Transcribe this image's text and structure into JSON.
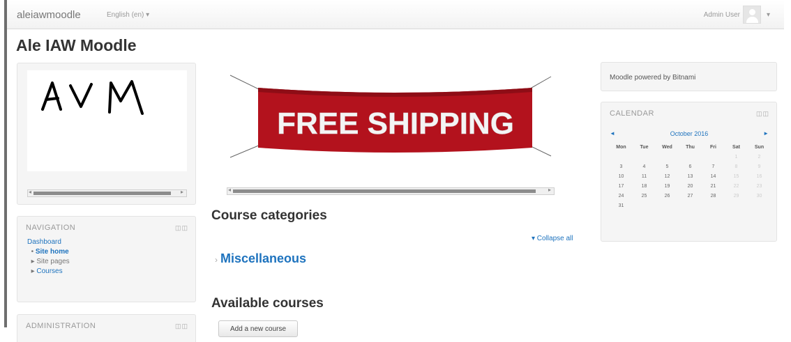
{
  "navbar": {
    "brand": "aleiawmoodle",
    "language": "English (en) ▾",
    "user_name": "Admin User",
    "user_caret": "▾"
  },
  "page_title": "Ale IAW Moodle",
  "logo_block": {
    "text": "AVM"
  },
  "navigation": {
    "title": "NAVIGATION",
    "controls": "◫◫",
    "items": [
      {
        "marker": "",
        "label": "Dashboard"
      },
      {
        "marker": "•",
        "label": "Site home"
      },
      {
        "marker": "▸",
        "label": "Site pages"
      },
      {
        "marker": "▸",
        "label": "Courses"
      }
    ]
  },
  "administration": {
    "title": "ADMINISTRATION",
    "controls": "◫◫"
  },
  "banner": {
    "text": "FREE SHIPPING"
  },
  "scroll_arrows": {
    "left": "◂",
    "right": "▸"
  },
  "main": {
    "categories_title": "Course categories",
    "collapse_all": "▾ Collapse all",
    "category_arrow": "›",
    "category_name": "Miscellaneous",
    "available_title": "Available courses",
    "add_course_button": "Add a new course"
  },
  "powered_block": {
    "text": "Moodle powered by Bitnami"
  },
  "calendar": {
    "title": "CALENDAR",
    "controls": "◫◫",
    "prev": "◄",
    "next": "►",
    "month": "October 2016",
    "weekdays": [
      "Mon",
      "Tue",
      "Wed",
      "Thu",
      "Fri",
      "Sat",
      "Sun"
    ],
    "weeks": [
      [
        "",
        "",
        "",
        "",
        "",
        "1",
        "2"
      ],
      [
        "3",
        "4",
        "5",
        "6",
        "7",
        "8",
        "9"
      ],
      [
        "10",
        "11",
        "12",
        "13",
        "14",
        "15",
        "16"
      ],
      [
        "17",
        "18",
        "19",
        "20",
        "21",
        "22",
        "23"
      ],
      [
        "24",
        "25",
        "26",
        "27",
        "28",
        "29",
        "30"
      ],
      [
        "31",
        "",
        "",
        "",
        "",
        "",
        ""
      ]
    ]
  },
  "colors": {
    "link": "#1e73be",
    "banner_red": "#b3121d",
    "block_bg": "#f5f5f5"
  }
}
